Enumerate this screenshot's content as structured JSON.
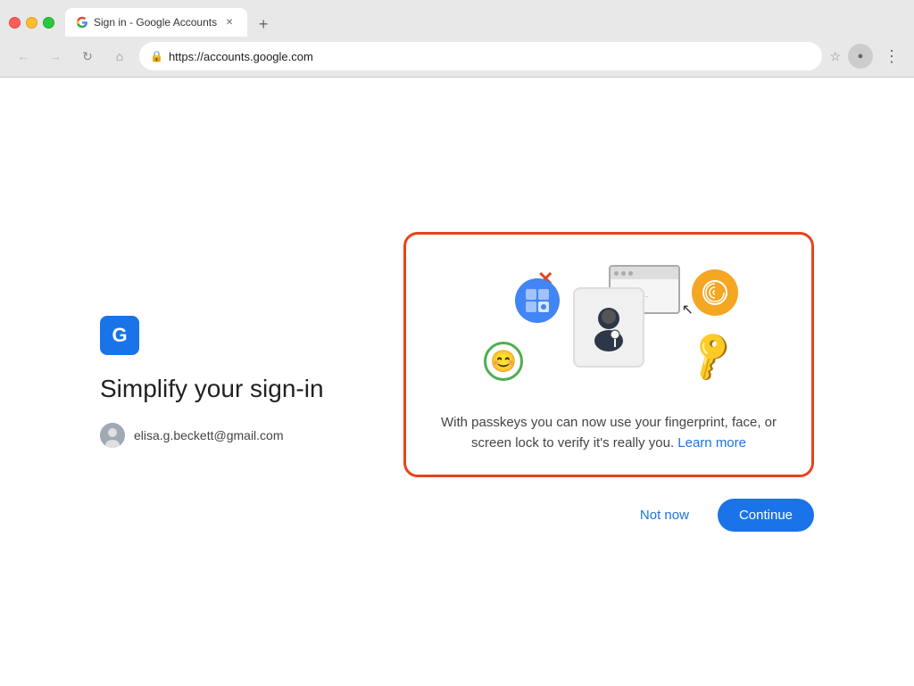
{
  "browser": {
    "tab_title": "Sign in - Google Accounts",
    "url": "https://accounts.google.com",
    "new_tab_label": "+",
    "back_tooltip": "Back",
    "forward_tooltip": "Forward",
    "refresh_tooltip": "Refresh",
    "home_tooltip": "Home"
  },
  "page": {
    "shield_letter": "G",
    "heading": "Simplify your sign-in",
    "user_email": "elisa.g.beckett@gmail.com",
    "card": {
      "body_text": "With passkeys you can now use your fingerprint, face, or screen lock to verify it's really you.",
      "learn_more_label": "Learn more"
    },
    "buttons": {
      "not_now_label": "Not now",
      "continue_label": "Continue"
    }
  }
}
